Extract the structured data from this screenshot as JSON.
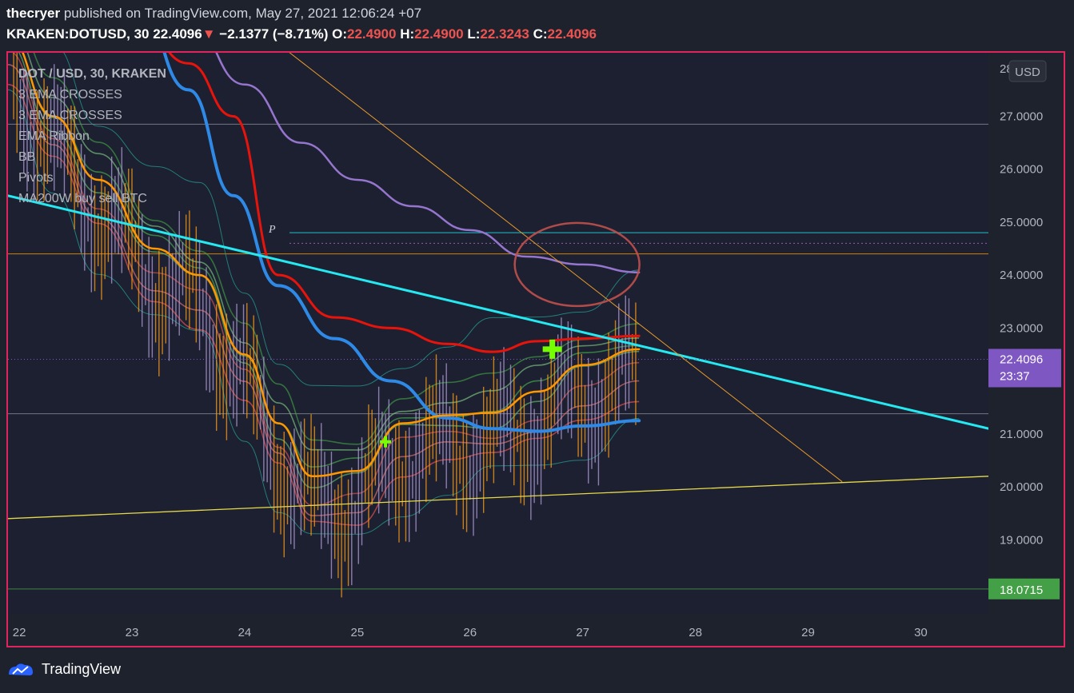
{
  "header": {
    "author": "thecryer",
    "published_text": "published on TradingView.com, May 27, 2021 12:06:24 +07",
    "symbol": "KRAKEN:DOTUSD, 30",
    "last": "22.4096",
    "arrow": "▼",
    "change": "−2.1377 (−8.71%)",
    "open_label": "O:",
    "open": "22.4900",
    "high_label": "H:",
    "high": "22.4900",
    "low_label": "L:",
    "low": "22.3243",
    "close_label": "C:",
    "close": "22.4096"
  },
  "legend": {
    "title": "DOT / USD, 30, KRAKEN",
    "indicators": [
      "3 EMA CROSSES",
      "3 EMA CROSSES",
      "EMA Ribbon",
      "BB",
      "Pivots",
      "MA200W buy sell BTC"
    ]
  },
  "colors": {
    "background": "#1e222d",
    "frame": "#e0245e",
    "ema_red": "#e8140c",
    "ema_blue": "#2e8ae6",
    "ema_orange": "#ff9800",
    "ema_purple": "#9575cd",
    "trend_cyan": "#26e8f0",
    "trend_yellow": "#e6d84a",
    "price_badge": "#7e57c2",
    "support_badge": "#43a047"
  },
  "chart_data": {
    "type": "line",
    "title": "DOT / USD, 30, KRAKEN",
    "currency_label": "USD",
    "x_ticks": [
      "22",
      "23",
      "24",
      "25",
      "26",
      "27",
      "28",
      "29",
      "30"
    ],
    "y_ticks": [
      "27.0000",
      "26.0000",
      "25.0000",
      "24.0000",
      "23.0000",
      "21.0000",
      "20.0000",
      "19.0000"
    ],
    "y_top_partial": "28",
    "ylim": [
      17.6,
      28.2
    ],
    "xlim": [
      21.9,
      30.6
    ],
    "last_price": {
      "value": 22.4096,
      "label": "22.4096",
      "countdown": "23:37"
    },
    "support_price": {
      "value": 18.0715,
      "label": "18.0715"
    },
    "pivot_label": "P",
    "pivot_level": 24.8,
    "horizontal_levels": [
      26.85,
      24.4,
      21.38,
      18.07
    ],
    "series": [
      {
        "name": "EMA red",
        "x": [
          21.9,
          23.0,
          23.5,
          23.9,
          24.3,
          24.8,
          25.3,
          25.8,
          26.2,
          26.6,
          27.0,
          27.5
        ],
        "values": [
          30.6,
          29.0,
          28.0,
          27.0,
          24.0,
          23.2,
          23.0,
          22.7,
          22.55,
          22.75,
          22.8,
          22.85
        ]
      },
      {
        "name": "EMA blue",
        "x": [
          21.9,
          23.0,
          23.5,
          23.9,
          24.3,
          24.8,
          25.3,
          25.8,
          26.2,
          26.6,
          27.0,
          27.5
        ],
        "values": [
          31.5,
          29.5,
          27.5,
          25.5,
          23.8,
          22.8,
          22.0,
          21.3,
          21.1,
          21.05,
          21.15,
          21.25
        ]
      },
      {
        "name": "EMA purple",
        "x": [
          21.9,
          23.0,
          23.5,
          24.0,
          24.5,
          25.0,
          25.5,
          26.0,
          26.5,
          27.0,
          27.5
        ],
        "values": [
          32.0,
          29.8,
          28.8,
          27.6,
          26.5,
          25.8,
          25.3,
          24.85,
          24.35,
          24.2,
          24.05
        ]
      },
      {
        "name": "EMA orange",
        "x": [
          21.9,
          22.3,
          22.7,
          23.2,
          23.6,
          24.0,
          24.3,
          24.6,
          25.0,
          25.4,
          25.8,
          26.2,
          26.6,
          27.0,
          27.5
        ],
        "values": [
          28.5,
          27.0,
          25.8,
          24.5,
          24.0,
          22.5,
          21.2,
          20.2,
          20.3,
          21.2,
          21.35,
          21.4,
          21.8,
          22.3,
          22.6
        ]
      },
      {
        "name": "Trend cyan",
        "x": [
          21.9,
          30.6
        ],
        "values": [
          25.5,
          21.1
        ]
      },
      {
        "name": "Trend yellow",
        "x": [
          21.9,
          30.6
        ],
        "values": [
          19.4,
          20.2
        ]
      },
      {
        "name": "Trend orange",
        "x": [
          24.4,
          29.3
        ],
        "values": [
          28.2,
          20.1
        ]
      }
    ],
    "markers": [
      {
        "type": "cross",
        "x": 25.25,
        "y": 20.85,
        "size": "small"
      },
      {
        "type": "cross",
        "x": 26.73,
        "y": 22.6,
        "size": "large"
      }
    ],
    "annotation": {
      "type": "ellipse",
      "x": 26.95,
      "y": 24.2
    }
  },
  "footer": {
    "brand": "TradingView"
  }
}
